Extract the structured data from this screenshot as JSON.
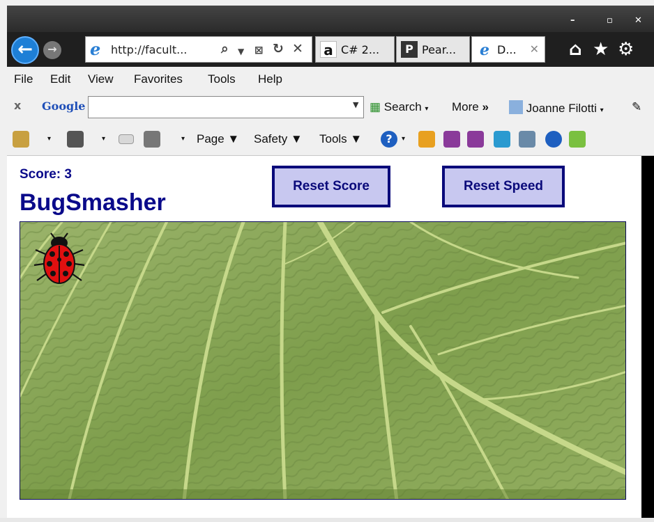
{
  "browser": {
    "address_text": "http://facult...",
    "tabs": [
      {
        "label": "C# 2...",
        "icon": "amazon-icon"
      },
      {
        "label": "Pear...",
        "icon": "pearson-icon"
      },
      {
        "label": "D...",
        "icon": "ie-icon"
      }
    ],
    "menu": [
      "File",
      "Edit",
      "View",
      "Favorites",
      "Tools",
      "Help"
    ],
    "googlebar": {
      "logo": "Google",
      "search_label": "Search",
      "more_label": "More",
      "user_label": "Joanne Filotti"
    },
    "commandbar": {
      "page_label": "Page",
      "safety_label": "Safety",
      "tools_label": "Tools"
    }
  },
  "game": {
    "score_text": "Score: 3",
    "title": "BugSmasher",
    "reset_score_label": "Reset Score",
    "reset_speed_label": "Reset Speed",
    "colors": {
      "heading": "#0a0a8a",
      "button_bg": "#c8c8f0",
      "leaf": "#8aa55a",
      "bug": "#e01010"
    }
  }
}
